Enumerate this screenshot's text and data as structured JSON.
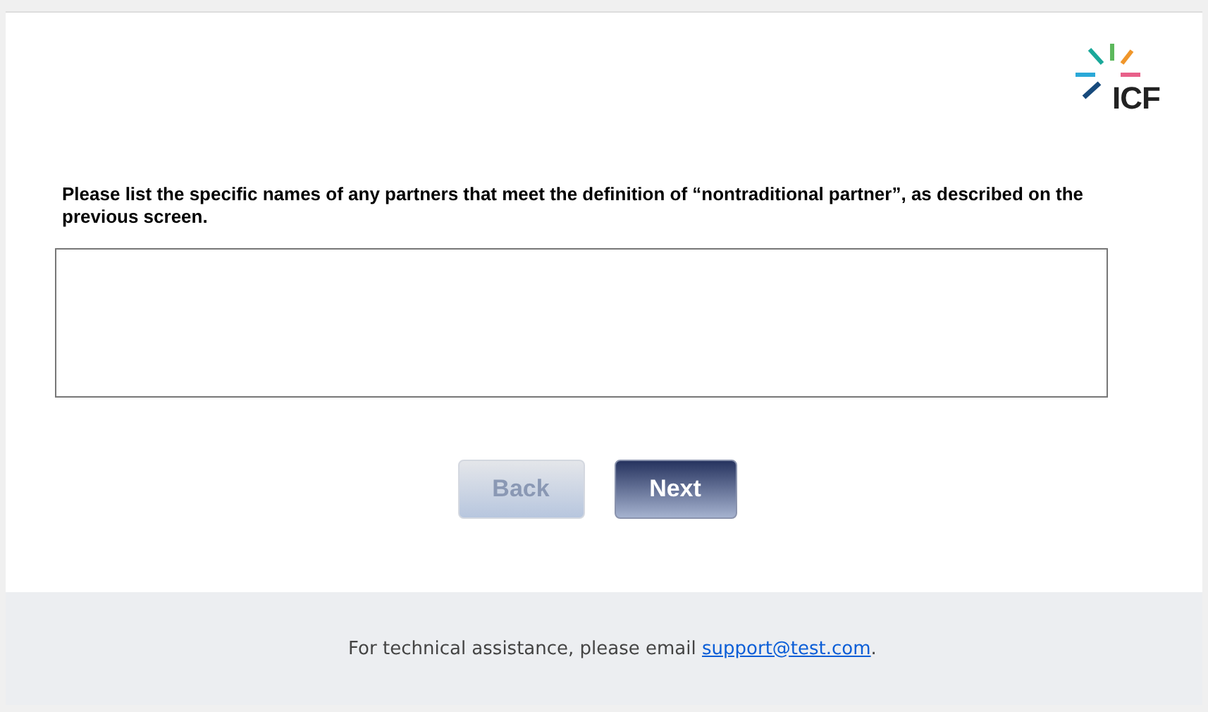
{
  "logo": {
    "text": "ICF"
  },
  "question": {
    "text": "Please list the specific names of any partners that meet the definition of “nontraditional partner”, as described on the previous screen."
  },
  "buttons": [
    {
      "label": "Back",
      "disabled": true
    },
    {
      "label": "Next",
      "disabled": false
    }
  ],
  "footer": {
    "text_before": "For technical assistance, please email ",
    "link": "support@test.com",
    "text_after": "."
  }
}
